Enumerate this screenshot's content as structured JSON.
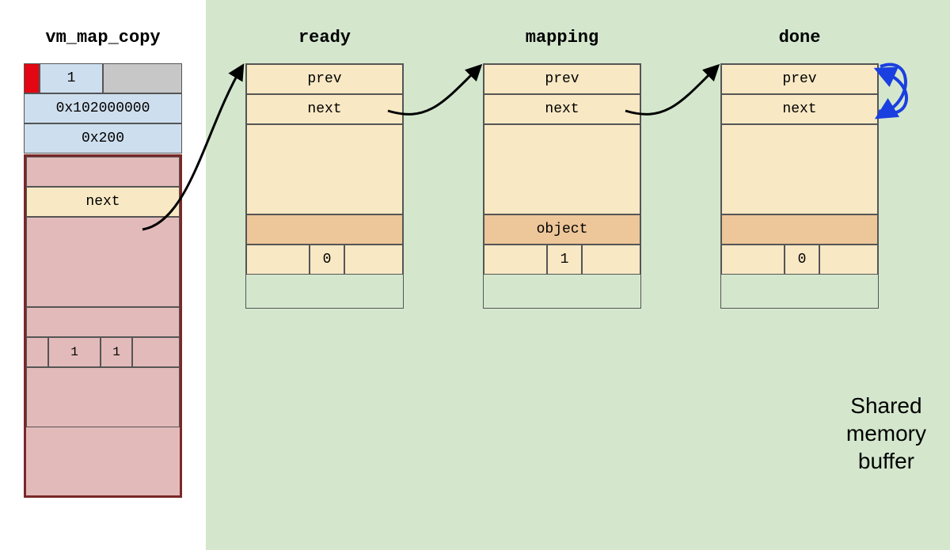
{
  "headers": {
    "vm": "vm_map_copy",
    "ready": "ready",
    "mapping": "mapping",
    "done": "done"
  },
  "vm_map_copy": {
    "type_value": "1",
    "offset": "0x102000000",
    "size": "0x200",
    "entry": {
      "next": "next",
      "flag1": "1",
      "flag2": "1"
    }
  },
  "entries": {
    "ready": {
      "prev": "prev",
      "next": "next",
      "object": "",
      "flag_val": "0"
    },
    "mapping": {
      "prev": "prev",
      "next": "next",
      "object": "object",
      "flag_val": "1"
    },
    "done": {
      "prev": "prev",
      "next": "next",
      "object": "",
      "flag_val": "0"
    }
  },
  "shared_label": {
    "line1": "Shared",
    "line2": "memory",
    "line3": "buffer"
  }
}
